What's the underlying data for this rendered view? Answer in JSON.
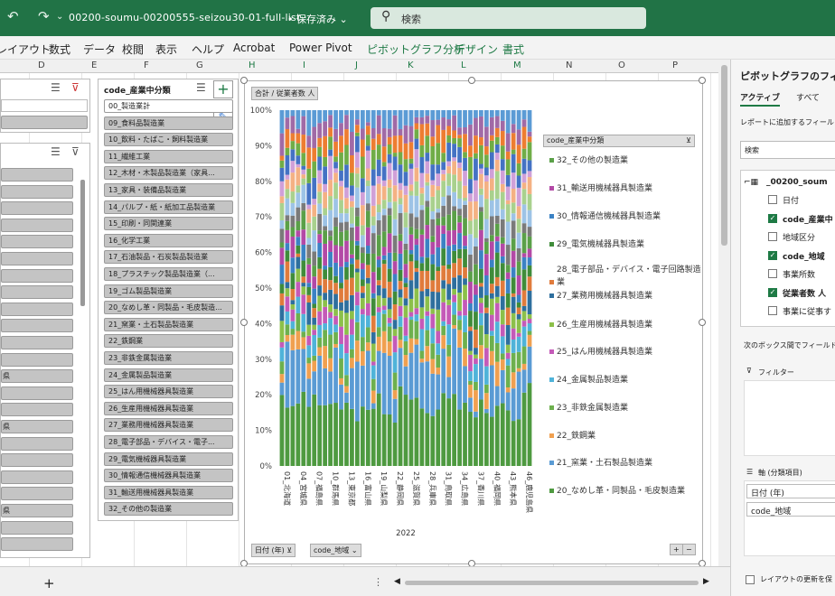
{
  "titlebar": {
    "filename": "00200-soumu-00200555-seizou30-01-full-list···",
    "saved": "• 保存済み ⌄",
    "search_placeholder": "検索",
    "bg": "#217346"
  },
  "menu": [
    "レイアウト",
    "数式",
    "データ",
    "校閲",
    "表示",
    "ヘルプ",
    "Acrobat",
    "Power Pivot",
    "ピボットグラフ分析",
    "デザイン",
    "書式"
  ],
  "columns": [
    "D",
    "E",
    "F",
    "G",
    "H",
    "I",
    "J",
    "K",
    "L",
    "M",
    "N",
    "O",
    "P"
  ],
  "slicer_industry": {
    "title": "code_産業中分類",
    "items": [
      "00_製造業計",
      "09_食料品製造業",
      "10_飲料・たばこ・飼料製造業",
      "11_繊維工業",
      "12_木材・木製品製造業（家具...",
      "13_家具・装備品製造業",
      "14_パルプ・紙・紙加工品製造業",
      "15_印刷・同関連業",
      "16_化学工業",
      "17_石油製品・石炭製品製造業",
      "18_プラスチック製品製造業（...",
      "19_ゴム製品製造業",
      "20_なめし革・同製品・毛皮製造...",
      "21_窯業・土石製品製造業",
      "22_鉄鋼業",
      "23_非鉄金属製造業",
      "24_金属製品製造業",
      "25_はん用機械器具製造業",
      "26_生産用機械器具製造業",
      "27_業務用機械器具製造業",
      "28_電子部品・デバイス・電子...",
      "29_電気機械器具製造業",
      "30_情報通信機械器具製造業",
      "31_輸送用機械器具製造業",
      "32_その他の製造業"
    ]
  },
  "left_fragments": [
    "県",
    "県",
    "県"
  ],
  "chart": {
    "field_button_value": "合計 / 従業者数 人",
    "legend_button": "code_産業中分類",
    "axis_buttons": [
      "日付 (年)",
      "code_地域"
    ],
    "year_label": "2022",
    "yticks": [
      "100%",
      "90%",
      "80%",
      "70%",
      "60%",
      "50%",
      "40%",
      "30%",
      "20%",
      "10%",
      "0%"
    ],
    "xlabels": [
      "01_北海道",
      "04_宮城県",
      "07_福島県",
      "10_群馬県",
      "13_東京都",
      "16_富山県",
      "19_山梨県",
      "22_静岡県",
      "25_滋賀県",
      "28_兵庫県",
      "31_鳥取県",
      "34_広島県",
      "37_香川県",
      "40_福岡県",
      "43_熊本県",
      "46_鹿児島県"
    ],
    "legend": [
      {
        "label": "32_その他の製造業",
        "color": "#5aa048"
      },
      {
        "label": "31_輸送用機械器具製造業",
        "color": "#b349a6"
      },
      {
        "label": "30_情報通信機械器具製造業",
        "color": "#3b82c4"
      },
      {
        "label": "29_電気機械器具製造業",
        "color": "#3f8c3a"
      },
      {
        "label": "28_電子部品・デバイス・電子回路製造業",
        "color": "#e07b3c"
      },
      {
        "label": "27_業務用機械器具製造業",
        "color": "#2e6f9e"
      },
      {
        "label": "26_生産用機械器具製造業",
        "color": "#8cc04a"
      },
      {
        "label": "25_はん用機械器具製造業",
        "color": "#c45ab8"
      },
      {
        "label": "24_金属製品製造業",
        "color": "#4fb3d9"
      },
      {
        "label": "23_非鉄金属製造業",
        "color": "#6db04e"
      },
      {
        "label": "22_鉄鋼業",
        "color": "#f0a050"
      },
      {
        "label": "21_窯業・土石製品製造業",
        "color": "#5a9bd4"
      },
      {
        "label": "20_なめし革・同製品・毛皮製造業",
        "color": "#4e9a40"
      }
    ]
  },
  "pane": {
    "title": "ピボットグラフのフィー",
    "tabs": [
      "アクティブ",
      "すべて"
    ],
    "instruction": "レポートに追加するフィール",
    "search_placeholder": "検索",
    "table_name": "_00200_soum",
    "fields": [
      {
        "label": "日付",
        "checked": false
      },
      {
        "label": "code_産業中",
        "checked": true
      },
      {
        "label": "地域区分",
        "checked": false
      },
      {
        "label": "code_地域",
        "checked": true
      },
      {
        "label": "事業所数",
        "checked": false
      },
      {
        "label": "従業者数 人",
        "checked": true
      },
      {
        "label": "事業に従事す",
        "checked": false
      }
    ],
    "areas_label": "次のボックス間でフィールド",
    "filter_label": "フィルター",
    "axis_label": "軸 (分類項目)",
    "axis_items": [
      "日付 (年)",
      "code_地域"
    ],
    "defer_label": "レイアウトの更新を保"
  },
  "chart_data": {
    "type": "bar",
    "stacked": "100%",
    "x": "code_地域 (47 prefectures, 2022)",
    "ylim": [
      0,
      100
    ],
    "ytick_labels": [
      "0%",
      "10%",
      "20%",
      "30%",
      "40%",
      "50%",
      "60%",
      "70%",
      "80%",
      "90%",
      "100%"
    ]
  }
}
